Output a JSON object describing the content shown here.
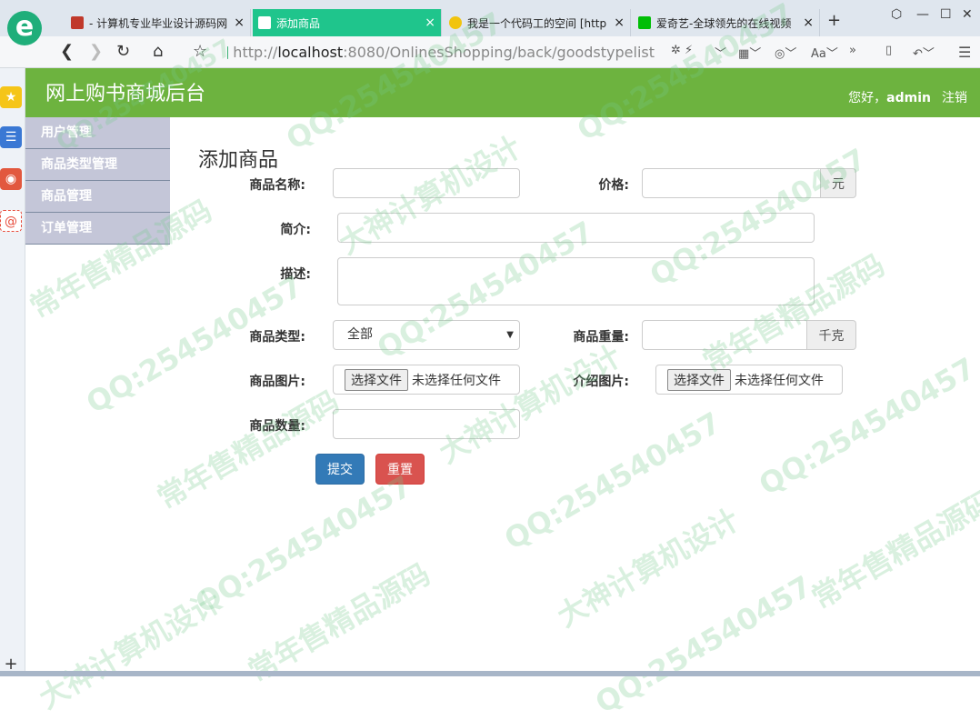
{
  "browser": {
    "logo_letter": "e",
    "tabs": [
      {
        "title": "- 计算机专业毕业设计源码网",
        "close": "×",
        "active": false
      },
      {
        "title": "添加商品",
        "close": "×",
        "active": true
      },
      {
        "title": "我是一个代码工的空间 [http",
        "close": "×",
        "active": false
      },
      {
        "title": "爱奇艺-全球领先的在线视频",
        "close": "×",
        "active": false
      }
    ],
    "new_tab": "+",
    "url_prefix": "http://",
    "url_host": "localhost",
    "url_rest": ":8080/OnlinesShopping/back/goodstypelist"
  },
  "app": {
    "title": "网上购书商城后台",
    "welcome_prefix": "您好，",
    "username": "admin",
    "logout": "注销"
  },
  "sidebar": {
    "items": [
      {
        "label": "用户管理"
      },
      {
        "label": "商品类型管理"
      },
      {
        "label": "商品管理"
      },
      {
        "label": "订单管理"
      }
    ]
  },
  "form": {
    "heading": "添加商品",
    "name_label": "商品名称:",
    "price_label": "价格:",
    "price_unit": "元",
    "intro_label": "简介:",
    "desc_label": "描述:",
    "type_label": "商品类型:",
    "type_selected": "全部",
    "weight_label": "商品重量:",
    "weight_unit": "千克",
    "image_label": "商品图片:",
    "intro_image_label": "介绍图片:",
    "file_button": "选择文件",
    "file_none": "未选择任何文件",
    "quantity_label": "商品数量:",
    "submit": "提交",
    "reset": "重置"
  },
  "watermark": {
    "qq": "QQ:254540457",
    "slogan_a": "常年售精品源码",
    "slogan_b": "大神计算机设计"
  },
  "colors": {
    "header": "#6db33f",
    "active_tab": "#1fc58c",
    "submit": "#337ab7",
    "reset": "#d9534f"
  }
}
